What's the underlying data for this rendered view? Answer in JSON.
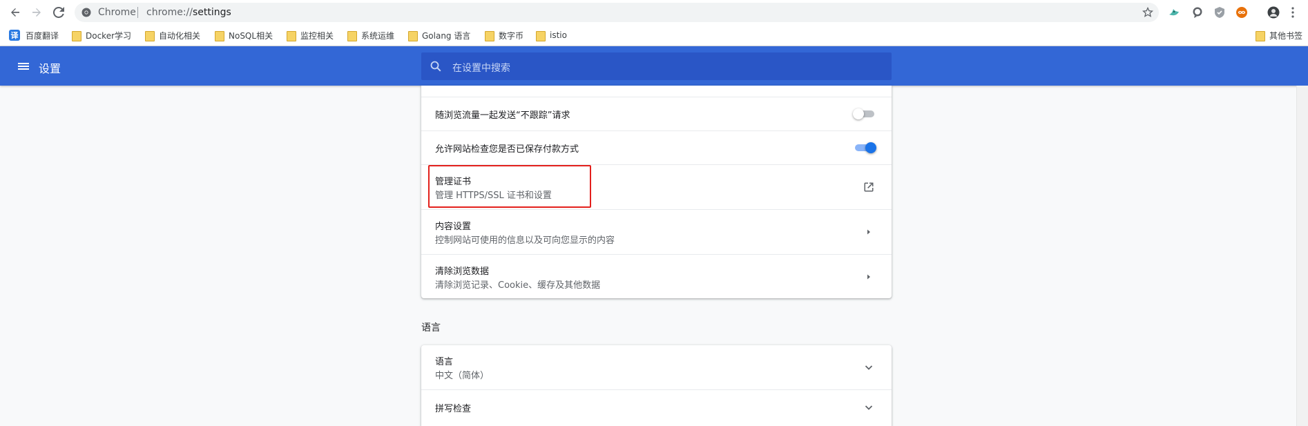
{
  "browser": {
    "site_name": "Chrome",
    "url_prefix": "chrome://",
    "url_path": "settings"
  },
  "bookmarks": [
    {
      "label": "百度翻译",
      "icon": "fanyi-icon"
    },
    {
      "label": "Docker学习",
      "icon": "folder-icon"
    },
    {
      "label": "自动化相关",
      "icon": "folder-icon"
    },
    {
      "label": "NoSQL相关",
      "icon": "folder-icon"
    },
    {
      "label": "监控相关",
      "icon": "folder-icon"
    },
    {
      "label": "系统运维",
      "icon": "folder-icon"
    },
    {
      "label": "Golang 语言",
      "icon": "folder-icon"
    },
    {
      "label": "数字币",
      "icon": "folder-icon"
    },
    {
      "label": "istio",
      "icon": "folder-icon"
    }
  ],
  "other_bookmarks": "其他书签",
  "fanyi_glyph": "译",
  "header": {
    "title": "设置",
    "search_placeholder": "在设置中搜索"
  },
  "privacy_rows": [
    {
      "title": "随浏览流量一起发送“不跟踪”请求",
      "control": "toggle",
      "state": false
    },
    {
      "title": "允许网站检查您是否已保存付款方式",
      "control": "toggle",
      "state": true
    },
    {
      "title": "管理证书",
      "subtitle": "管理 HTTPS/SSL 证书和设置",
      "control": "open-in-new"
    },
    {
      "title": "内容设置",
      "subtitle": "控制网站可使用的信息以及可向您显示的内容",
      "control": "arrow-right"
    },
    {
      "title": "清除浏览数据",
      "subtitle": "清除浏览记录、Cookie、缓存及其他数据",
      "control": "arrow-right"
    }
  ],
  "language_section": {
    "title": "语言",
    "rows": [
      {
        "title": "语言",
        "subtitle": "中文（简体）",
        "control": "expand"
      },
      {
        "title": "拼写检查",
        "control": "expand"
      }
    ]
  },
  "colors": {
    "header": "#3367d6",
    "search": "#2a56c6",
    "toggle_on": "#1a73e8",
    "highlight": "#e3201c"
  }
}
